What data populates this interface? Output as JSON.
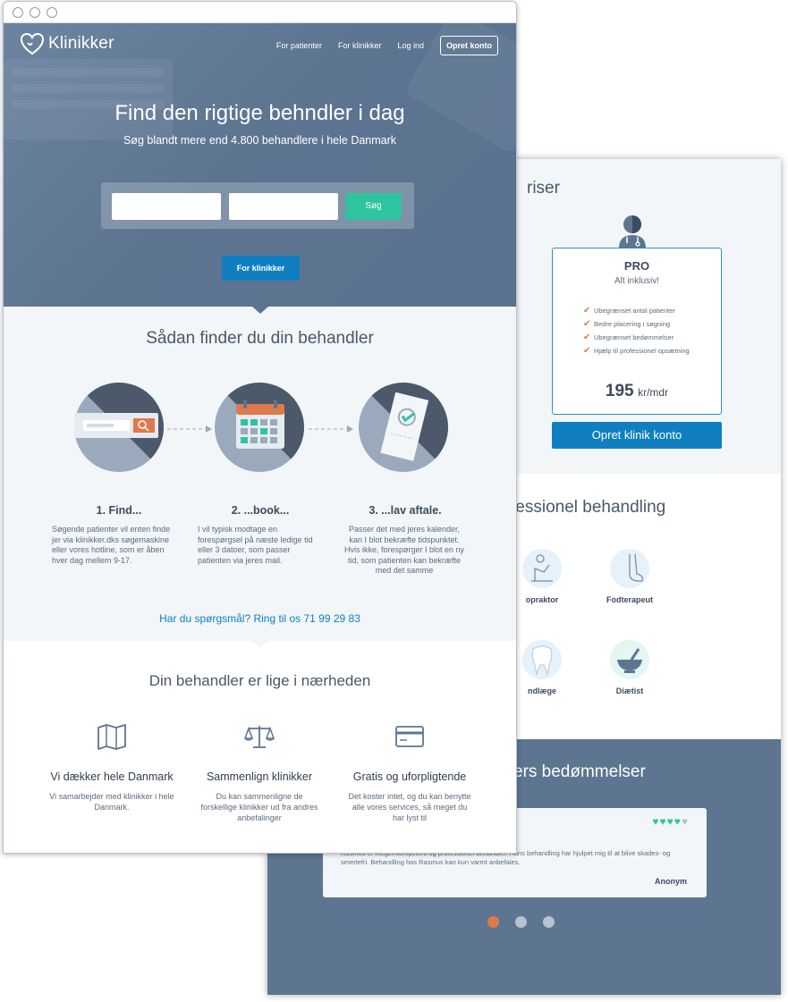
{
  "colors": {
    "hero_bg": "#5d7591",
    "primary_blue": "#0f7fc0",
    "accent_teal": "#2fc4a0",
    "accent_orange": "#e07a4b",
    "light_bg": "#f2f6f9"
  },
  "back_page": {
    "pricing": {
      "heading": "riser",
      "plan": {
        "icon": "doctor-icon",
        "name": "PRO",
        "subtitle": "Alt inklusiv!",
        "features": [
          "Ubegrænset antal patienter",
          "Bedre placering i søgning",
          "Ubegrænset bedømmelser",
          "Hjælp til professionel opsætning"
        ],
        "price_amount": "195",
        "price_unit": "kr/mdr"
      },
      "cta_label": "Opret klinik konto"
    },
    "specialties": {
      "heading": "fessionel behandling",
      "items": [
        {
          "label": "opraktor",
          "icon": "chiropractor-icon"
        },
        {
          "label": "Fodterapeut",
          "icon": "foot-icon"
        },
        {
          "label": "ndlæge",
          "icon": "tooth-icon"
        },
        {
          "label": "Diætist",
          "icon": "mortar-icon"
        }
      ]
    },
    "reviews": {
      "heading": "ers bedømmelser",
      "rating_filled": 4,
      "rating_max": 5,
      "text": "Rasmus er meget kompetent og professionel behandler. Hans behandling har hjulpet mig til at blive skades- og smertefri. Behandling hos Rasmus kan kun varmt anbefales.",
      "author": "Anonym",
      "carousel_count": 3,
      "carousel_active": 1
    }
  },
  "front_page": {
    "brand": "Klinikker",
    "nav": {
      "patients": "For patienter",
      "clinics": "For klinikker",
      "login": "Log ind",
      "signup": "Opret konto"
    },
    "hero": {
      "title": "Find den rigtige behndler i dag",
      "subtitle": "Søg blandt mere end 4.800 behandlere i hele Danmark",
      "search_field_1": "",
      "search_field_2": "",
      "search_button": "Søg",
      "clinic_button": "For klinikker"
    },
    "how": {
      "title": "Sådan finder du din behandler",
      "steps": [
        {
          "icon": "search-bar-icon",
          "title": "1. Find...",
          "text": "Søgende patienter vil enten finde jer via klinikker.dks søgemaskine eller vores hotline, som er åben hver dag mellem 9-17."
        },
        {
          "icon": "calendar-icon",
          "title": "2. ...book...",
          "text": "I vil typisk modtage en forespørgsel på næste ledige tid eller 3 datoer, som passer patienten via jeres mail."
        },
        {
          "icon": "ticket-check-icon",
          "title": "3. ...lav aftale.",
          "text": "Passer det med jeres kalender, kan I blot bekræfte tidspunktet. Hvis ikke, forespørger I blot en ny tid, som patienten kan bekræfte med det samme"
        }
      ],
      "phone_cta": "Har du spørgsmål? Ring til os 71 99 29 83"
    },
    "near": {
      "title": "Din behandler er lige i nærheden",
      "features": [
        {
          "icon": "map-icon",
          "title": "Vi dækker hele Danmark",
          "text": "Vi samarbejder med klinikker i hele Danmark."
        },
        {
          "icon": "scales-icon",
          "title": "Sammenlign klinikker",
          "text": "Du kan sammenligne de forskellige klinikker ud fra andres anbefalinger"
        },
        {
          "icon": "card-icon",
          "title": "Gratis og uforpligtende",
          "text": "Det koster intet, og du kan benytte alle vores services, så meget du har lyst til"
        }
      ]
    }
  }
}
